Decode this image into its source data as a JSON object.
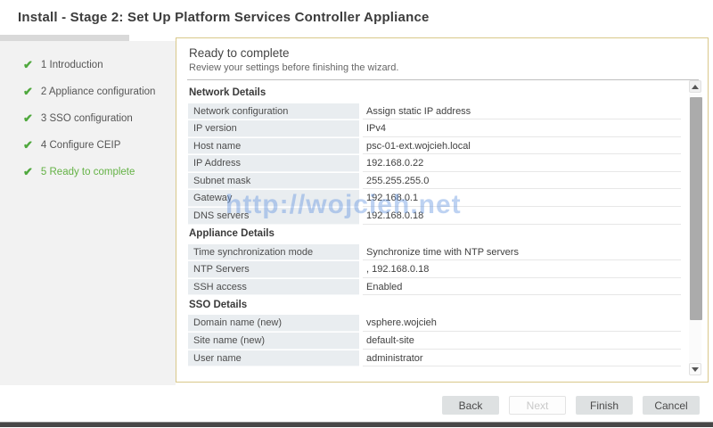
{
  "window": {
    "title": "Install - Stage 2: Set Up Platform Services Controller Appliance"
  },
  "sidebar": {
    "check_icon": "✔",
    "steps": [
      {
        "num": "1",
        "label": "1 Introduction",
        "current": false
      },
      {
        "num": "2",
        "label": "2 Appliance configuration",
        "current": false
      },
      {
        "num": "3",
        "label": "3 SSO configuration",
        "current": false
      },
      {
        "num": "4",
        "label": "4 Configure CEIP",
        "current": false
      },
      {
        "num": "5",
        "label": "5 Ready to complete",
        "current": true
      }
    ]
  },
  "main": {
    "heading": "Ready to complete",
    "subheading": "Review your settings before finishing the wizard.",
    "watermark": "http://wojcieh.net",
    "sections": [
      {
        "title": "Network Details",
        "rows": [
          {
            "label": "Network configuration",
            "value": "Assign static IP address"
          },
          {
            "label": "IP version",
            "value": "IPv4"
          },
          {
            "label": "Host name",
            "value": "psc-01-ext.wojcieh.local"
          },
          {
            "label": "IP Address",
            "value": "192.168.0.22"
          },
          {
            "label": "Subnet mask",
            "value": "255.255.255.0"
          },
          {
            "label": "Gateway",
            "value": "192.168.0.1"
          },
          {
            "label": "DNS servers",
            "value": "192.168.0.18"
          }
        ]
      },
      {
        "title": "Appliance Details",
        "rows": [
          {
            "label": "Time synchronization mode",
            "value": "Synchronize time with NTP servers"
          },
          {
            "label": "NTP Servers",
            "value": ", 192.168.0.18"
          },
          {
            "label": "SSH access",
            "value": "Enabled"
          }
        ]
      },
      {
        "title": "SSO Details",
        "rows": [
          {
            "label": "Domain name (new)",
            "value": "vsphere.wojcieh"
          },
          {
            "label": "Site name (new)",
            "value": "default-site"
          },
          {
            "label": "User name",
            "value": "administrator"
          }
        ]
      }
    ]
  },
  "footer": {
    "buttons": [
      {
        "label": "Back",
        "enabled": true
      },
      {
        "label": "Next",
        "enabled": false
      },
      {
        "label": "Finish",
        "enabled": true
      },
      {
        "label": "Cancel",
        "enabled": true
      }
    ]
  },
  "colors": {
    "accent_green": "#64b245",
    "check_green": "#4fa83d",
    "panel_border": "#d9c88a",
    "label_cell_bg": "#e9edf0",
    "watermark_blue": "#6294e0",
    "button_bg": "#dee1e2",
    "bottom_bar": "#474747"
  }
}
